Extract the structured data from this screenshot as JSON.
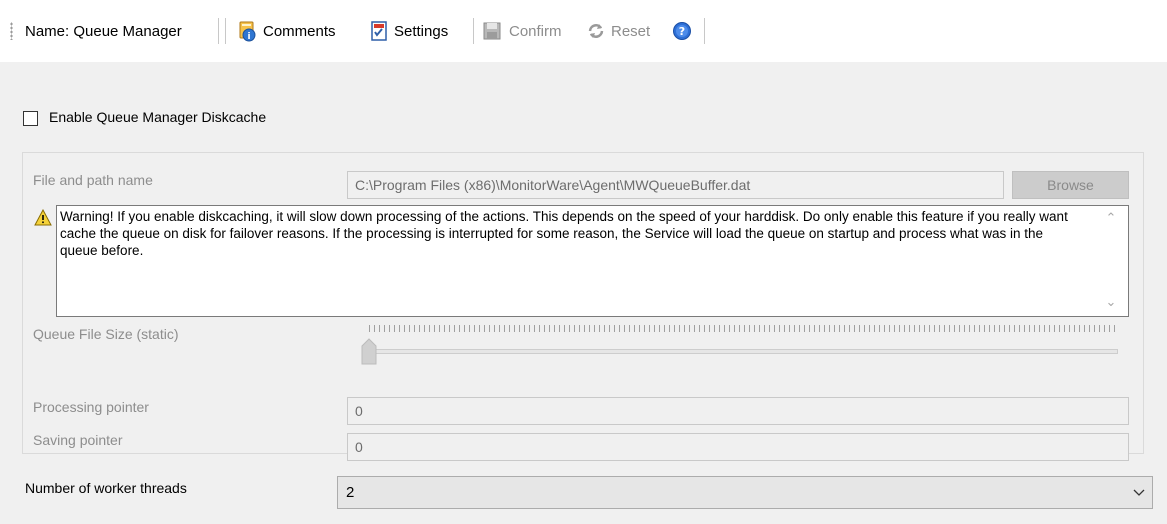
{
  "toolbar": {
    "name_label": "Name: Queue Manager",
    "comments_label": "Comments",
    "settings_label": "Settings",
    "confirm_label": "Confirm",
    "reset_label": "Reset",
    "icons": [
      "comments-icon",
      "settings-icon",
      "confirm-save-icon",
      "reset-icon",
      "help-icon"
    ]
  },
  "diskcache": {
    "checkbox_label": "Enable Queue Manager Diskcache",
    "checked": false
  },
  "file": {
    "label": "File and path name",
    "value": "C:\\Program Files (x86)\\MonitorWare\\Agent\\MWQueueBuffer.dat",
    "browse_label": "Browse"
  },
  "warning": {
    "text": "Warning! If you enable diskcaching, it will slow down processing of the actions. This depends on the speed of your harddisk. Do only enable this feature if you really want cache the queue on disk for failover reasons. If the processing is interrupted for some reason, the Service will load the queue on startup and process what was in the queue before."
  },
  "queue_size": {
    "label": "Queue File Size (static)",
    "slider_position": 0
  },
  "pointers": {
    "processing_label": "Processing pointer",
    "processing_value": "0",
    "saving_label": "Saving pointer",
    "saving_value": "0"
  },
  "workers": {
    "label": "Number of worker threads",
    "value": "2"
  },
  "colors": {
    "disabled_text": "#8d8d8d",
    "toolbar_bg": "#ffffff",
    "window_bg": "#f0f0f0"
  }
}
